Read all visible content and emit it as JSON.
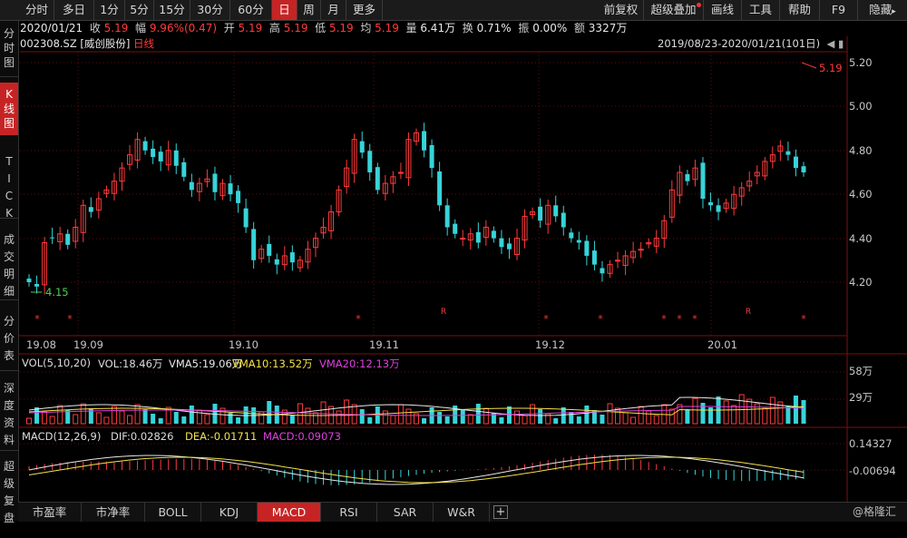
{
  "toolbar": {
    "periods": [
      "分时",
      "多日",
      "1分",
      "5分",
      "15分",
      "30分",
      "60分",
      "日",
      "周",
      "月",
      "更多"
    ],
    "active_period": "日",
    "right_buttons": [
      "前复权",
      "超级叠加",
      "画线",
      "工具",
      "帮助",
      "F9",
      "隐藏"
    ]
  },
  "left_nav": {
    "items": [
      "分时图",
      "K线图",
      "TICK",
      "成交明细",
      "分价表",
      "深度资料",
      "超级复盘"
    ],
    "active": "K线图"
  },
  "quote": {
    "date": "2020/01/21",
    "close_label": "收",
    "close": "5.19",
    "change_label": "幅",
    "change": "9.96%(0.47)",
    "open_label": "开",
    "open": "5.19",
    "high_label": "高",
    "high": "5.19",
    "low_label": "低",
    "low": "5.19",
    "avg_label": "均",
    "avg": "5.19",
    "volume_label": "量",
    "volume": "6.41万",
    "turnover_label": "换",
    "turnover": "0.71%",
    "amplitude_label": "振",
    "amplitude": "0.00%",
    "amount_label": "额",
    "amount": "3327万"
  },
  "stock": {
    "code": "002308.SZ",
    "name": "[威创股份]",
    "period_label": "日线"
  },
  "range_label": "2019/08/23-2020/01/21(101日)",
  "price_axis": {
    "ticks": [
      "5.20",
      "5.00",
      "4.80",
      "4.60",
      "4.40",
      "4.20"
    ],
    "last_price_label": "5.19",
    "low_marker_label": "4.15"
  },
  "date_axis": [
    "19.08",
    "19.09",
    "19.10",
    "19.11",
    "19.12",
    "20.01"
  ],
  "markers": {
    "star": "*",
    "r": "R"
  },
  "volume_panel": {
    "title": "VOL(5,10,20)",
    "vol": "VOL:18.46万",
    "vma5": "VMA5:19.06万",
    "vma10": "VMA10:13.52万",
    "vma20": "VMA20:12.13万",
    "axis_ticks": [
      "58万",
      "29万"
    ]
  },
  "macd_panel": {
    "title": "MACD(12,26,9)",
    "dif": "DIF:0.02826",
    "dea": "DEA:-0.01711",
    "macd": "MACD:0.09073",
    "axis_ticks": [
      "0.14327",
      "-0.00694"
    ]
  },
  "bottom_tabs": [
    "市盈率",
    "市净率",
    "BOLL",
    "KDJ",
    "MACD",
    "RSI",
    "SAR",
    "W&R"
  ],
  "bottom_active": "MACD",
  "bottom_plus": "+",
  "watermark": "@格隆汇",
  "colors": {
    "up": "#ff3b3b",
    "down": "#36d4d9",
    "active": "#c62424",
    "vma5": "#e8e8e8",
    "vma10": "#f5e14a",
    "vma20": "#e040e0"
  }
}
